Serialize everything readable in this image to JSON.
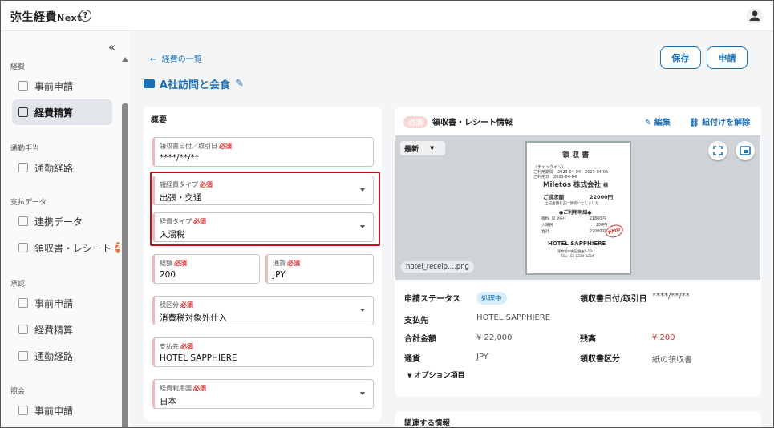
{
  "app": {
    "brand": "弥生経費",
    "brand_suffix": "Next",
    "help": "?"
  },
  "sidebar": {
    "sections": [
      {
        "label": "経費",
        "items": [
          {
            "label": "事前申請"
          },
          {
            "label": "経費精算"
          }
        ]
      },
      {
        "label": "通勤手当",
        "items": [
          {
            "label": "通勤経路"
          }
        ]
      },
      {
        "label": "支払データ",
        "items": [
          {
            "label": "連携データ"
          },
          {
            "label": "領収書・レシート",
            "badge": "2"
          }
        ]
      },
      {
        "label": "承認",
        "items": [
          {
            "label": "事前申請"
          },
          {
            "label": "経費精算"
          },
          {
            "label": "通勤経路"
          }
        ]
      },
      {
        "label": "照会",
        "items": [
          {
            "label": "事前申請"
          }
        ]
      }
    ]
  },
  "header": {
    "back_label": "経費の一覧",
    "title": "A社訪問と会食",
    "save_label": "保存",
    "submit_label": "申請"
  },
  "form": {
    "section_title": "概要",
    "required": "必須",
    "fields": {
      "date": {
        "label": "領収書日付／取引日",
        "value": "****/**/**"
      },
      "parent_type": {
        "label": "親経費タイプ",
        "value": "出張・交通"
      },
      "type": {
        "label": "経費タイプ",
        "value": "入湯税"
      },
      "amount": {
        "label": "総額",
        "value": "200"
      },
      "currency": {
        "label": "通貨",
        "value": "JPY"
      },
      "tax": {
        "label": "税区分",
        "value": "消費税対象外仕入"
      },
      "payee": {
        "label": "支払先",
        "value": "HOTEL SAPPHIERE"
      },
      "country": {
        "label": "経費利用国",
        "value": "日本"
      }
    }
  },
  "receipt_panel": {
    "badge": "必須",
    "title": "領収書・レシート情報",
    "edit_label": "編集",
    "unlink_label": "紐付けを解除",
    "version": "最新",
    "file_name": "hotel_receip....png",
    "receipt_image": {
      "heading": "領 収 書",
      "lines": [
        "（チェックイン）",
        "ご利用期間　2023-04-04 - 2023-04-05",
        "ご利用日　2023-04-04"
      ],
      "company": "Miletos 株式会社",
      "honorific": "様",
      "amount_label": "ご請求額",
      "amount": "22000円",
      "note": "上記金額を正に領収いたしました",
      "detail_title": "●ご利用明細●",
      "details": [
        [
          "宿料（2 泊分）",
          "21800円"
        ],
        [
          "入湯税",
          "200円"
        ],
        [
          "合計",
          "22000円"
        ]
      ],
      "stamp": "PAID",
      "hotel": "HOTEL SAPPHIERE",
      "address": "東京都中央区銀座5-10-1",
      "tel": "TEL：03-1234-1234"
    },
    "details": {
      "status_label": "申請ステータス",
      "status": "処理中",
      "date_label": "領収書日付/取引日",
      "date": "****/**/**",
      "payee_label": "支払先",
      "payee": "HOTEL SAPPHIERE",
      "total_label": "合計金額",
      "total": "¥ 22,000",
      "balance_label": "残高",
      "balance": "¥ 200",
      "currency_label": "通貨",
      "currency": "JPY",
      "rtype_label": "領収書区分",
      "rtype": "紙の領収書"
    },
    "options_label": "オプション項目"
  },
  "related": {
    "title": "関連する情報"
  },
  "colors": {
    "accent": "#1a6fb5",
    "required": "#d33",
    "highlight_border": "#c4111b",
    "balance": "#d33",
    "badge": "#e8783c"
  }
}
